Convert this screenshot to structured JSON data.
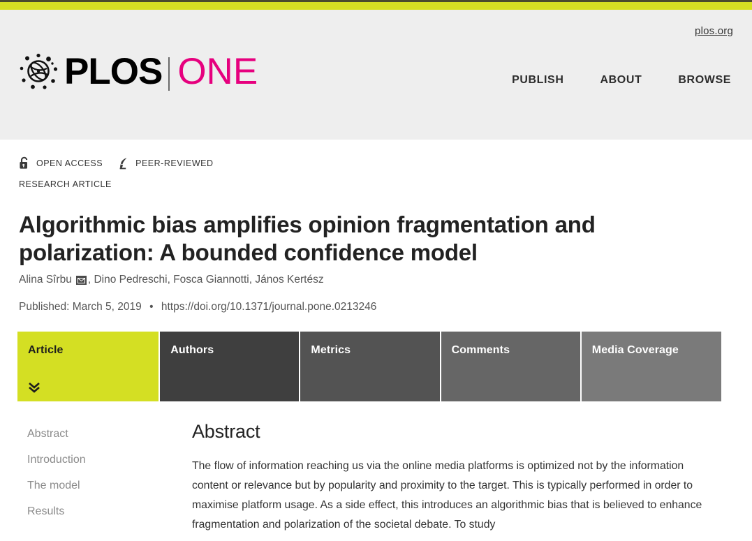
{
  "top": {
    "accent_color": "#d6de23"
  },
  "header": {
    "plos_org_link": "plos.org",
    "logo": {
      "primary": "PLOS",
      "secondary": "ONE",
      "secondary_color": "#e6007e"
    },
    "nav": [
      {
        "label": "PUBLISH"
      },
      {
        "label": "ABOUT"
      },
      {
        "label": "BROWSE"
      }
    ]
  },
  "meta": {
    "badges": [
      {
        "label": "OPEN ACCESS",
        "icon": "unlock-icon"
      },
      {
        "label": "PEER-REVIEWED",
        "icon": "quill-icon"
      }
    ],
    "article_type": "RESEARCH ARTICLE"
  },
  "article": {
    "title": "Algorithmic bias amplifies opinion fragmentation and polarization: A bounded confidence model",
    "authors": [
      {
        "name": "Alina Sîrbu",
        "corresponding": true
      },
      {
        "name": "Dino Pedreschi",
        "corresponding": false
      },
      {
        "name": "Fosca Giannotti",
        "corresponding": false
      },
      {
        "name": "János Kertész",
        "corresponding": false
      }
    ],
    "published_label": "Published: March 5, 2019",
    "separator": "•",
    "doi": "https://doi.org/10.1371/journal.pone.0213246"
  },
  "tabs": [
    {
      "label": "Article",
      "active": true
    },
    {
      "label": "Authors",
      "active": false
    },
    {
      "label": "Metrics",
      "active": false
    },
    {
      "label": "Comments",
      "active": false
    },
    {
      "label": "Media Coverage",
      "active": false
    }
  ],
  "side_nav": [
    {
      "label": "Abstract"
    },
    {
      "label": "Introduction"
    },
    {
      "label": "The model"
    },
    {
      "label": "Results"
    }
  ],
  "main": {
    "abstract_heading": "Abstract",
    "abstract_text": "The flow of information reaching us via the online media platforms is optimized not by the information content or relevance but by popularity and proximity to the target. This is typically performed in order to maximise platform usage. As a side effect, this introduces an algorithmic bias that is believed to enhance fragmentation and polarization of the societal debate. To study"
  }
}
